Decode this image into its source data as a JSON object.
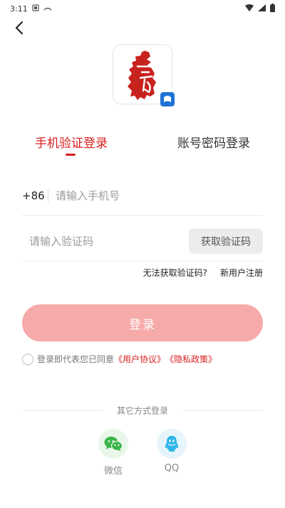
{
  "status_bar": {
    "time": "3:11"
  },
  "tabs": {
    "phone_login": "手机验证登录",
    "account_login": "账号密码登录"
  },
  "phone": {
    "country_code": "+86",
    "placeholder": "请输入手机号"
  },
  "verify": {
    "placeholder": "请输入验证码",
    "get_code_label": "获取验证码"
  },
  "links": {
    "cannot_get_code": "无法获取验证码?",
    "new_user_register": "新用户注册"
  },
  "login_button": "登录",
  "agreement": {
    "prefix": "登录即代表您已同意",
    "user_agreement": "《用户协议》",
    "privacy_policy": "《隐私政策》"
  },
  "other_login": {
    "title": "其它方式登录",
    "wechat_label": "微信",
    "qq_label": "QQ"
  },
  "colors": {
    "accent": "#d81e1e",
    "login_button": "#f6aaaa",
    "wechat_green": "#3bb54a",
    "qq_blue": "#32b6e8"
  },
  "icons": [
    "back-arrow-icon",
    "app-logo-icon",
    "logo-badge-icon",
    "wechat-icon",
    "qq-icon",
    "wifi-icon",
    "signal-icon",
    "battery-icon",
    "notification-icon",
    "sim-icon"
  ]
}
